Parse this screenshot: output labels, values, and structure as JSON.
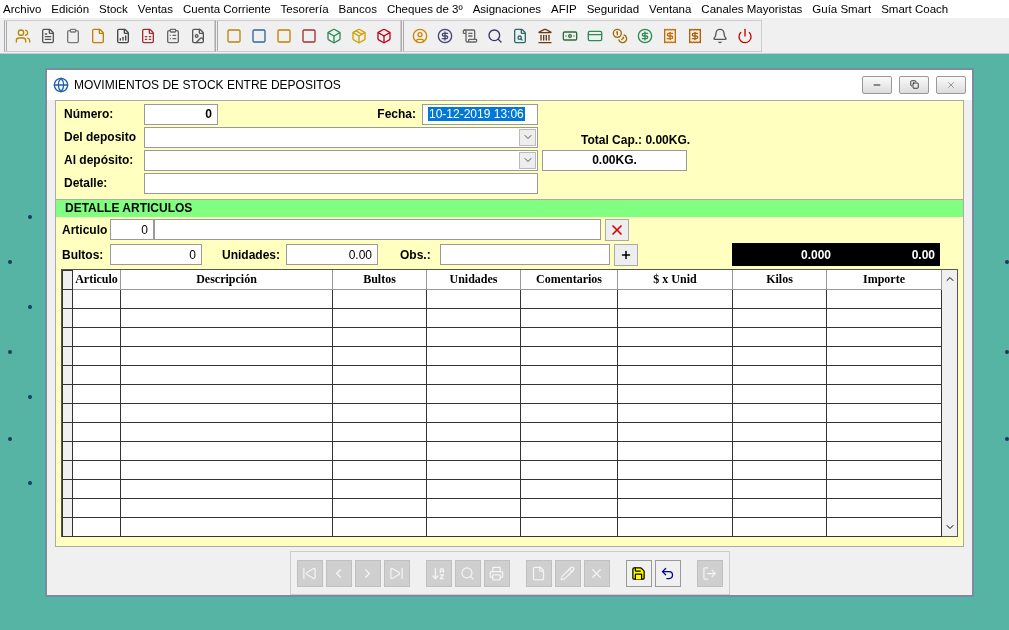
{
  "menu": [
    "Archivo",
    "Edición",
    "Stock",
    "Ventas",
    "Cuenta Corriente",
    "Tesorería",
    "Bancos",
    "Cheques de 3º",
    "Asignaciones",
    "AFIP",
    "Seguridad",
    "Ventana",
    "Canales Mayoristas",
    "Guía Smart",
    "Smart Coach"
  ],
  "window": {
    "title": "MOVIMIENTOS DE  STOCK ENTRE DEPOSITOS"
  },
  "header": {
    "numero": {
      "label": "Número:",
      "value": "0"
    },
    "fecha": {
      "label": "Fecha:",
      "value": "10-12-2019 13:06",
      "selected": true
    },
    "del_deposito": {
      "label": "Del deposito"
    },
    "al_deposito": {
      "label": "Al depósito:"
    },
    "detalle": {
      "label": "Detalle:"
    },
    "total_cap": "Total Cap.: 0.00KG.",
    "kg_value": "0.00KG."
  },
  "detail": {
    "title": "DETALLE ARTICULOS",
    "articulo": {
      "label": "Articulo",
      "code": "0"
    },
    "bultos": {
      "label": "Bultos:",
      "value": "0"
    },
    "unidades": {
      "label": "Unidades:",
      "value": "0.00"
    },
    "obs": {
      "label": "Obs.:"
    },
    "totals": [
      "0.000",
      "0.00"
    ]
  },
  "table": {
    "columns": [
      "Articulo",
      "Descripción",
      "Bultos",
      "Unidades",
      "Comentarios",
      "$ x Unid",
      "Kilos",
      "Importe"
    ]
  },
  "nav_buttons": [
    {
      "kind": "first",
      "disabled": true
    },
    {
      "kind": "prev",
      "disabled": true
    },
    {
      "kind": "next",
      "disabled": true
    },
    {
      "kind": "last",
      "disabled": true
    },
    {
      "kind": "sort",
      "disabled": true
    },
    {
      "kind": "find",
      "disabled": true
    },
    {
      "kind": "print",
      "disabled": true
    },
    {
      "kind": "new",
      "disabled": true
    },
    {
      "kind": "edit",
      "disabled": true
    },
    {
      "kind": "delete",
      "disabled": true
    },
    {
      "kind": "save",
      "disabled": false
    },
    {
      "kind": "undo",
      "disabled": false
    },
    {
      "kind": "exit",
      "disabled": true
    }
  ]
}
